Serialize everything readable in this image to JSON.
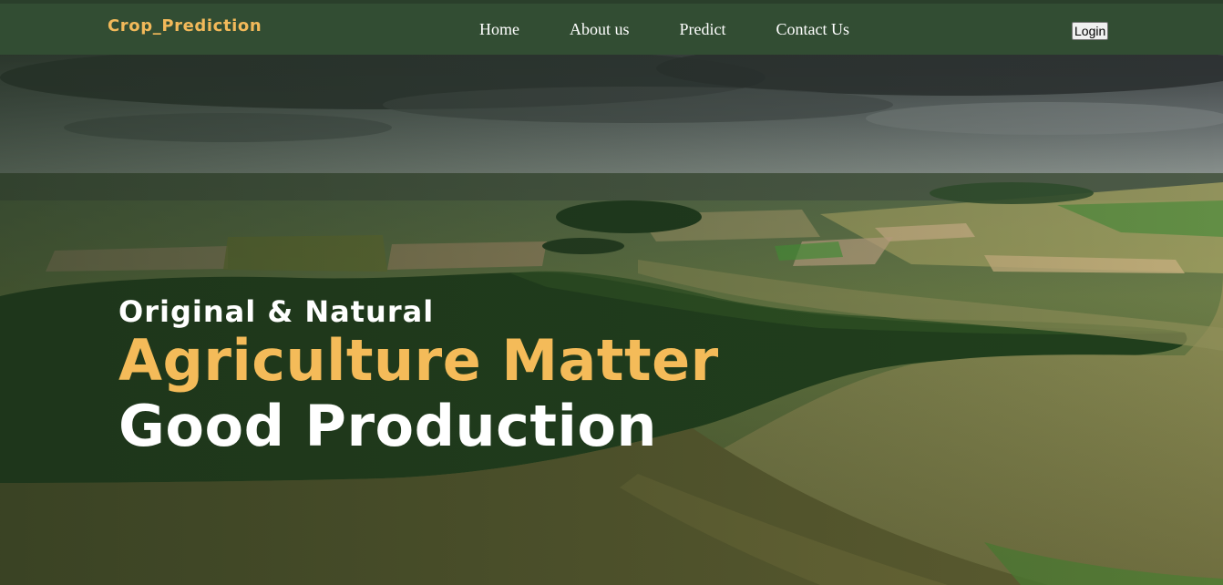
{
  "navbar": {
    "brand": "Crop_Prediction",
    "links": [
      {
        "label": "Home"
      },
      {
        "label": "About us"
      },
      {
        "label": "Predict"
      },
      {
        "label": "Contact Us"
      }
    ],
    "login_label": "Login"
  },
  "hero": {
    "tagline": "Original & Natural",
    "headline_line1": "Agriculture Matter",
    "headline_line2": "Good Production"
  },
  "colors": {
    "navbar_bg": "#324d33",
    "brand": "#f2b95a",
    "accent_headline": "#f4bb59",
    "text_light": "#ffffff"
  }
}
